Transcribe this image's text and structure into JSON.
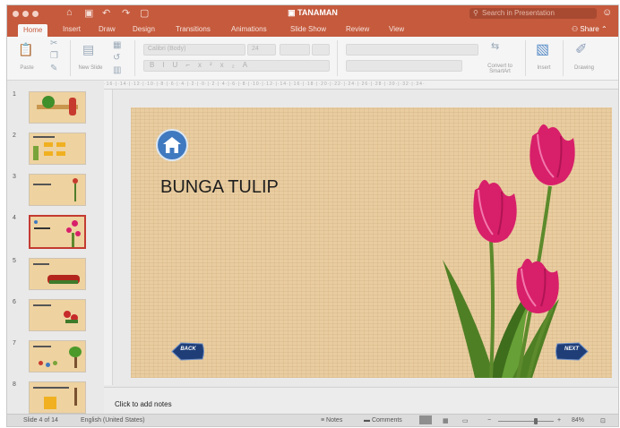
{
  "window": {
    "title": "TANAMAN",
    "search_placeholder": "Search in Presentation"
  },
  "ribbon": {
    "tabs": [
      "Home",
      "Insert",
      "Draw",
      "Design",
      "Transitions",
      "Animations",
      "Slide Show",
      "Review",
      "View"
    ],
    "active_tab": "Home",
    "share_label": "Share",
    "paste_label": "Paste",
    "new_slide_label": "New Slide",
    "font_name": "Calibri (Body)",
    "font_size": "24",
    "convert_label": "Convert to SmartArt",
    "insert_label": "Insert",
    "drawing_label": "Drawing"
  },
  "thumbnails": {
    "numbers": [
      "1",
      "2",
      "3",
      "4",
      "5",
      "6",
      "7",
      "8"
    ],
    "selected": 4
  },
  "slide": {
    "title": "BUNGA TULIP",
    "back_label": "BACK",
    "next_label": "NEXT"
  },
  "notes": {
    "placeholder": "Click to add notes"
  },
  "status": {
    "slide_info": "Slide 4 of 14",
    "language": "English (United States)",
    "notes_label": "Notes",
    "comments_label": "Comments",
    "zoom": "84%"
  },
  "colors": {
    "accent": "#c55a3d",
    "tulip": "#d81f6a",
    "leaf": "#5c8a2c",
    "slide_bg": "#e9cda0",
    "nav_button": "#1f3e78"
  },
  "icons": [
    "home-icon",
    "undo-icon",
    "redo-icon",
    "search-icon",
    "smiley-icon",
    "share-icon",
    "paste-icon",
    "new-slide-icon",
    "insert-icon",
    "drawing-icon"
  ]
}
